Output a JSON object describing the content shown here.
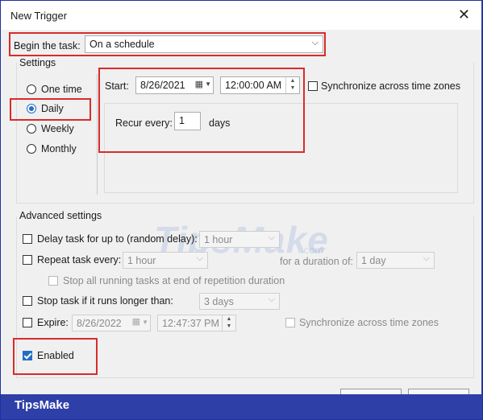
{
  "window": {
    "title": "New Trigger"
  },
  "begin": {
    "label": "Begin the task:",
    "value": "On a schedule"
  },
  "settings": {
    "label": "Settings",
    "radios": [
      {
        "label": "One time",
        "selected": false
      },
      {
        "label": "Daily",
        "selected": true
      },
      {
        "label": "Weekly",
        "selected": false
      },
      {
        "label": "Monthly",
        "selected": false
      }
    ],
    "start_label": "Start:",
    "start_date": "8/26/2021",
    "start_time": "12:00:00 AM",
    "sync_label": "Synchronize across time zones",
    "recur_label": "Recur every:",
    "recur_value": "1",
    "recur_unit": "days"
  },
  "advanced": {
    "label": "Advanced settings",
    "delay_label": "Delay task for up to (random delay):",
    "delay_value": "1 hour",
    "repeat_label": "Repeat task every:",
    "repeat_value": "1 hour",
    "duration_label": "for a duration of:",
    "duration_value": "1 day",
    "stop_running_label": "Stop all running tasks at end of repetition duration",
    "stop_longer_label": "Stop task if it runs longer than:",
    "stop_longer_value": "3 days",
    "expire_label": "Expire:",
    "expire_date": "8/26/2022",
    "expire_time": "12:47:37 PM",
    "expire_sync_label": "Synchronize across time zones",
    "enabled_label": "Enabled"
  },
  "watermark": {
    "main": "TipsMake",
    "suffix": ".com"
  },
  "footer": {
    "brand": "TipsMake"
  }
}
